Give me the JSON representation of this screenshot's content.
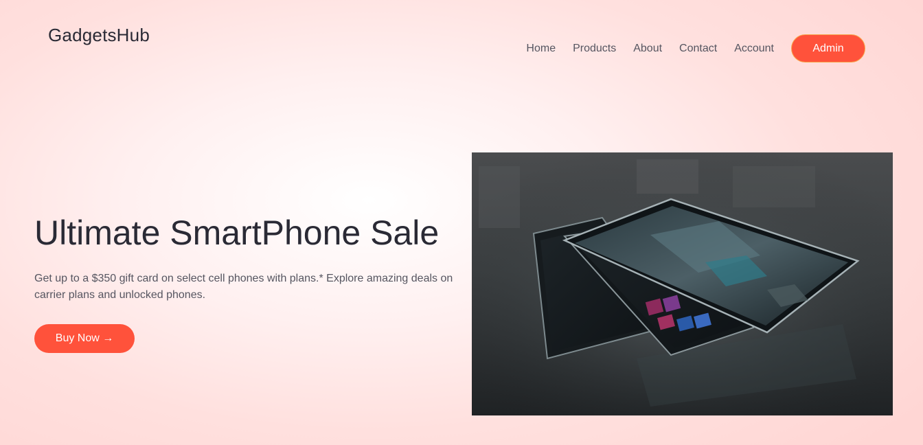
{
  "header": {
    "logo": "GadgetsHub",
    "nav": [
      "Home",
      "Products",
      "About",
      "Contact",
      "Account"
    ],
    "admin_label": "Admin"
  },
  "hero": {
    "title": "Ultimate SmartPhone Sale",
    "description": "Get up to a $350 gift card on select cell phones with plans.* Explore amazing deals on carrier plans and unlocked phones.",
    "cta_label": "Buy Now →",
    "image_subject": "smartphones-photo"
  },
  "colors": {
    "accent": "#ff523b",
    "text_dark": "#2a2a35",
    "text_muted": "#555560",
    "background_tint": "#ffd6d4"
  }
}
